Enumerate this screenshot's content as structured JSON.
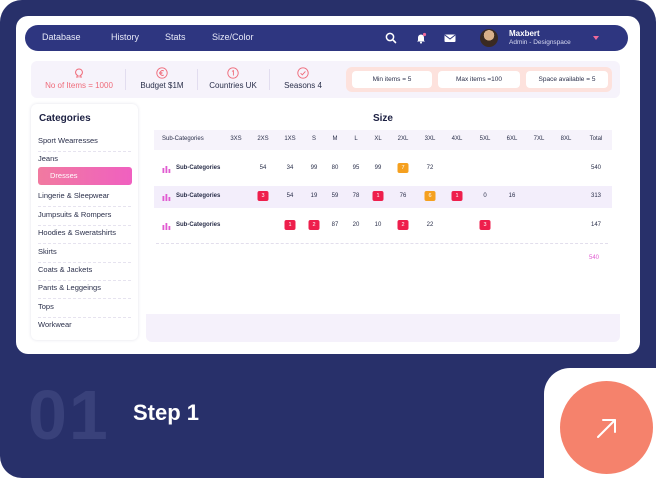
{
  "nav": {
    "items": [
      "Database",
      "History",
      "Stats",
      "Size/Color"
    ],
    "user_name": "Maxbert",
    "user_role": "Admin - Designspace",
    "icons": [
      "search-icon",
      "bell-icon",
      "mail-icon",
      "chevron-down-icon"
    ]
  },
  "stats": {
    "items": [
      {
        "label": "No of Items = 1000",
        "icon": "omega-icon",
        "highlight": true
      },
      {
        "label": "Budget $1M",
        "icon": "euro-icon",
        "highlight": false
      },
      {
        "label": "Countries UK",
        "icon": "number-icon",
        "highlight": false
      },
      {
        "label": "Seasons 4",
        "icon": "check-badge-icon",
        "highlight": false
      }
    ],
    "limits": [
      "Min items = 5",
      "Max items =100",
      "Space available = 5"
    ]
  },
  "sidebar": {
    "title": "Categories",
    "items": [
      "Sport Wearresses",
      "Jeans",
      "Dresses",
      "Lingerie & Sleepwear",
      "Jumpsuits & Rompers",
      "Hoodies & Sweratshirts",
      "Skirts",
      "Coats & Jackets",
      "Pants & Leggeings",
      "Tops",
      "Workwear"
    ],
    "active_index": 2
  },
  "table": {
    "title": "Size",
    "headers": [
      "Sub-Categories",
      "3XS",
      "2XS",
      "1XS",
      "S",
      "M",
      "L",
      "XL",
      "2XL",
      "3XL",
      "4XL",
      "5XL",
      "6XL",
      "7XL",
      "8XL",
      "Total"
    ],
    "rows": [
      {
        "label": "Sub-Categories",
        "cells": [
          "",
          "54",
          "34",
          "99",
          "80",
          "95",
          "99",
          {
            "badge": "7",
            "color": "orange"
          },
          "72",
          "",
          "",
          "",
          "",
          "",
          "540"
        ]
      },
      {
        "label": "Sub-Categories",
        "cells": [
          "",
          {
            "badge": "3",
            "color": "red"
          },
          "54",
          "19",
          "59",
          "78",
          {
            "badge": "1",
            "color": "red"
          },
          "76",
          {
            "badge": "6",
            "color": "orange"
          },
          {
            "badge": "1",
            "color": "red"
          },
          "0",
          "16",
          "",
          "",
          "313"
        ]
      },
      {
        "label": "Sub-Categories",
        "cells": [
          "",
          "",
          {
            "badge": "1",
            "color": "red"
          },
          {
            "badge": "2",
            "color": "red"
          },
          "87",
          "20",
          "10",
          {
            "badge": "2",
            "color": "red"
          },
          "22",
          "",
          {
            "badge": "3",
            "color": "red"
          },
          "",
          "",
          "",
          "147"
        ]
      }
    ],
    "grand_total": "540"
  },
  "step": {
    "number": "01",
    "label": "Step 1"
  },
  "colors": {
    "frame": "#28306a",
    "nav": "#2e3680",
    "accent_pink": "#f060c0",
    "badge_red": "#ee1f4c",
    "badge_orange": "#f5a01f",
    "cta": "#f5826c"
  }
}
